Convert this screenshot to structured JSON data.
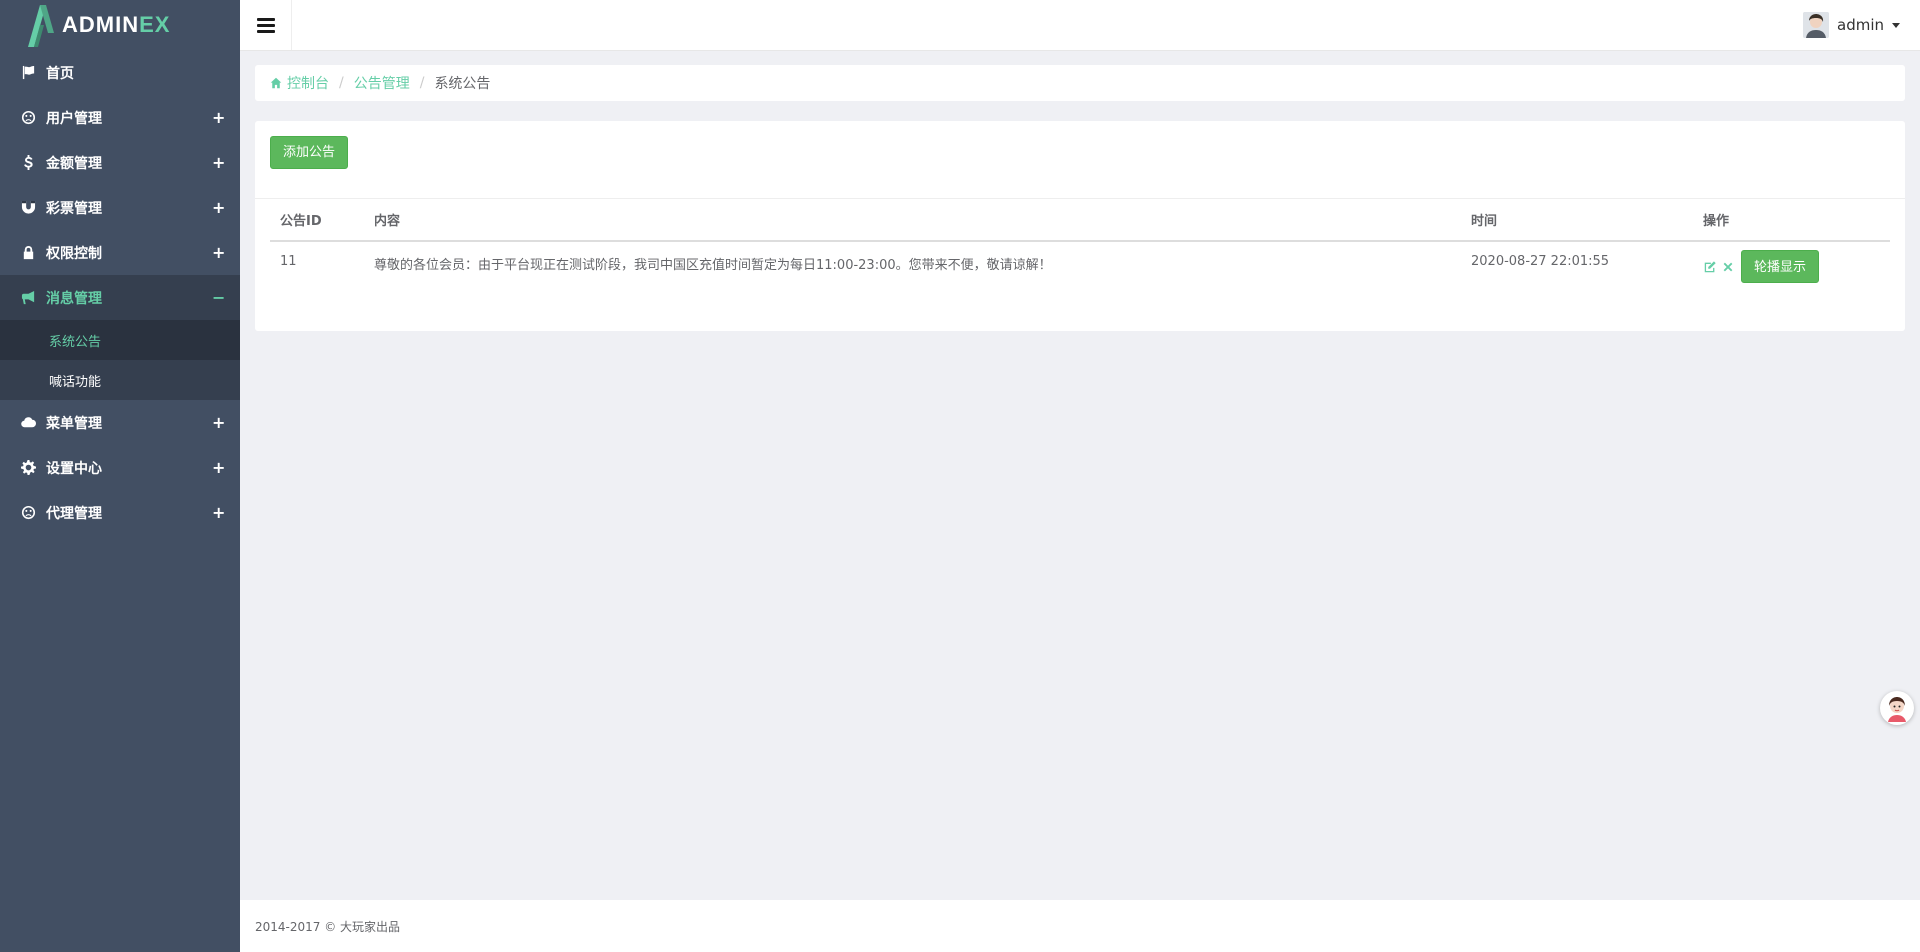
{
  "brand": {
    "name_main": "ADMIN",
    "name_accent": "EX"
  },
  "sidebar": {
    "items": [
      {
        "label": "首页",
        "icon": "flag-icon",
        "toggle": ""
      },
      {
        "label": "用户管理",
        "icon": "frown-icon",
        "toggle": "+"
      },
      {
        "label": "金额管理",
        "icon": "dollar-icon",
        "toggle": "+"
      },
      {
        "label": "彩票管理",
        "icon": "magnet-icon",
        "toggle": "+"
      },
      {
        "label": "权限控制",
        "icon": "lock-icon",
        "toggle": "+"
      },
      {
        "label": "消息管理",
        "icon": "bullhorn-icon",
        "toggle": "−"
      },
      {
        "label": "菜单管理",
        "icon": "cloud-icon",
        "toggle": "+"
      },
      {
        "label": "设置中心",
        "icon": "gear-icon",
        "toggle": "+"
      },
      {
        "label": "代理管理",
        "icon": "frown-icon",
        "toggle": "+"
      }
    ],
    "sub_items": [
      {
        "label": "系统公告"
      },
      {
        "label": "喊话功能"
      }
    ]
  },
  "header": {
    "user_name": "admin"
  },
  "breadcrumb": {
    "home": "控制台",
    "level2": "公告管理",
    "current": "系统公告"
  },
  "panel": {
    "add_button": "添加公告",
    "columns": [
      "公告ID",
      "内容",
      "时间",
      "操作"
    ],
    "rows": [
      {
        "id": "11",
        "content": "尊敬的各位会员：由于平台现正在测试阶段，我司中国区充值时间暂定为每日11:00-23:00。您带来不便，敬请谅解！",
        "time": "2020-08-27 22:01:55",
        "action_label": "轮播显示"
      }
    ]
  },
  "footer": {
    "text": "2014-2017 © 大玩家出品"
  },
  "colors": {
    "sidebar_bg": "#424f63",
    "accent": "#65cea7",
    "success": "#5cb85c"
  }
}
